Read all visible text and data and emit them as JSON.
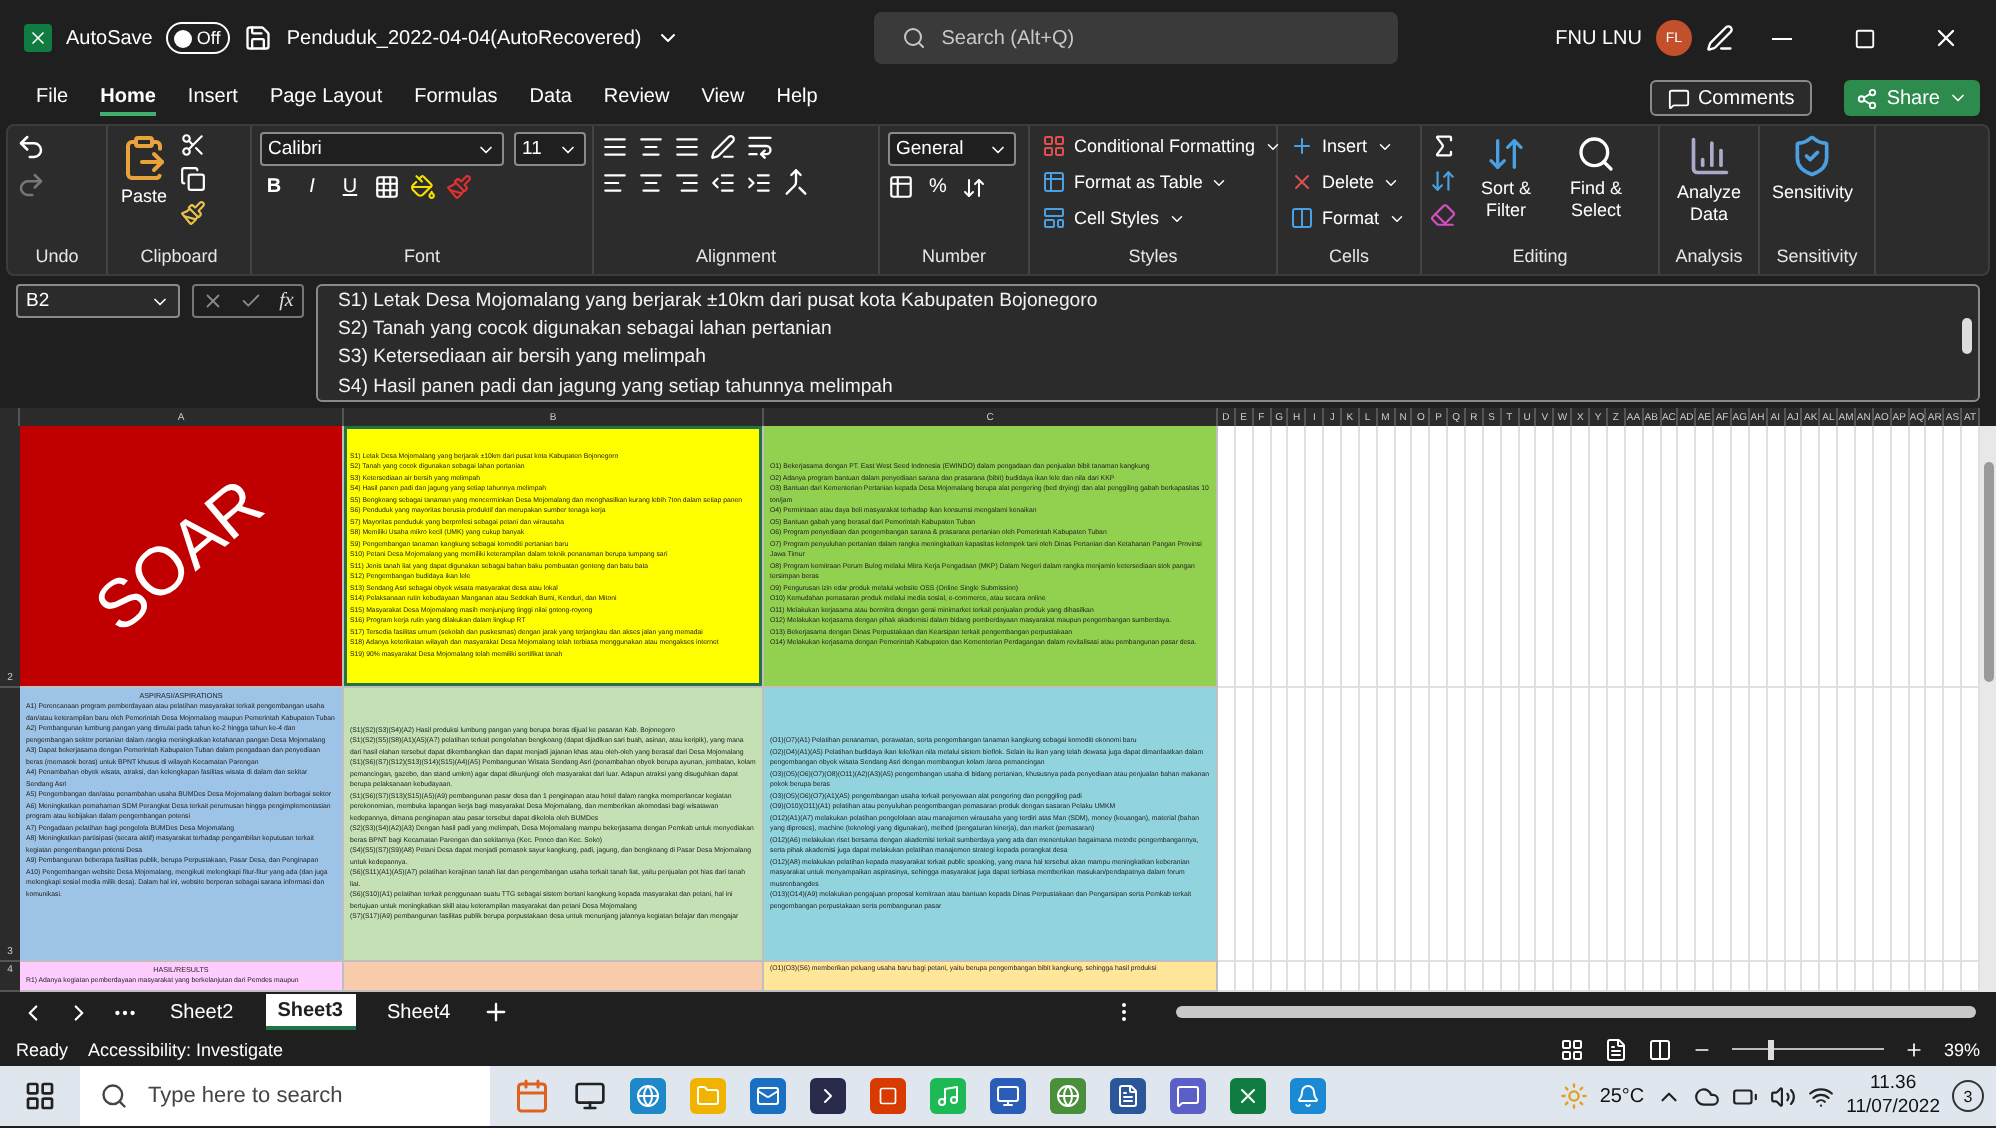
{
  "title_bar": {
    "autosave_label": "AutoSave",
    "autosave": {
      "on": false,
      "label": "Off"
    },
    "filename": "Penduduk_2022-04-04(AutoRecovered)",
    "search_placeholder": "Search (Alt+Q)",
    "user_name": "FNU LNU",
    "avatar_initials": "FL"
  },
  "menu": [
    {
      "label": "File",
      "selected": false
    },
    {
      "label": "Home",
      "selected": true
    },
    {
      "label": "Insert",
      "selected": false
    },
    {
      "label": "Page Layout",
      "selected": false
    },
    {
      "label": "Formulas",
      "selected": false
    },
    {
      "label": "Data",
      "selected": false
    },
    {
      "label": "Review",
      "selected": false
    },
    {
      "label": "View",
      "selected": false
    },
    {
      "label": "Help",
      "selected": false
    }
  ],
  "actions": {
    "comments": "Comments",
    "share": "Share"
  },
  "ribbon": [
    {
      "kind": "undo",
      "label": "Undo"
    },
    {
      "kind": "clipboard",
      "label": "Clipboard",
      "items": [
        "Paste"
      ]
    },
    {
      "kind": "font",
      "label": "Font",
      "items": [
        "Calibri",
        "11",
        "B",
        "I",
        "U"
      ]
    },
    {
      "kind": "alignment",
      "label": "Alignment"
    },
    {
      "kind": "number",
      "label": "Number",
      "items": [
        "General",
        "%"
      ]
    },
    {
      "kind": "styles",
      "label": "Styles",
      "items": [
        "Conditional Formatting",
        "Format as Table",
        "Cell Styles"
      ]
    },
    {
      "kind": "cells",
      "label": "Cells",
      "items": [
        "Insert",
        "Delete",
        "Format"
      ]
    },
    {
      "kind": "editing",
      "label": "Editing",
      "items": [
        "Sort & Filter",
        "Find & Select"
      ]
    },
    {
      "kind": "analysis",
      "label": "Analysis",
      "items": [
        "Analyze Data"
      ]
    },
    {
      "kind": "sensitivity",
      "label": "Sensitivity",
      "items": [
        "Sensitivity"
      ]
    }
  ],
  "formula_bar": {
    "name_box": "B2",
    "fx_label": "fx",
    "lines": [
      "S1) Letak Desa Mojomalang yang berjarak ±10km dari pusat kota Kabupaten Bojonegoro",
      "S2) Tanah yang cocok digunakan sebagai lahan pertanian",
      "S3) Ketersediaan air bersih yang melimpah",
      "S4) Hasil panen padi dan jagung yang setiap tahunnya melimpah"
    ]
  },
  "sheet": {
    "columns": [
      "A",
      "B",
      "C",
      "D",
      "E",
      "F",
      "G",
      "H",
      "I",
      "J",
      "K",
      "L",
      "M",
      "N",
      "O",
      "P",
      "Q",
      "R",
      "S",
      "T",
      "U",
      "V",
      "W",
      "X",
      "Y",
      "Z",
      "AA",
      "AB",
      "AC",
      "AD",
      "AE",
      "AF",
      "AG",
      "AH",
      "AI",
      "AJ",
      "AK",
      "AL",
      "AM",
      "AN",
      "AO",
      "AP",
      "AQ",
      "AR",
      "AS",
      "AT"
    ],
    "rows": [
      {
        "number": "2",
        "cells": [
          {
            "kind": "banner",
            "color": "#c00000",
            "selected": false,
            "text": "SOAR"
          },
          {
            "kind": "list",
            "color": "#ffff00",
            "selected": true,
            "lines": [
              "S1) Letak Desa Mojomalang yang berjarak ±10km dari pusat kota Kabupaten Bojonegoro",
              "S2) Tanah yang cocok digunakan sebagai lahan pertanian",
              "S3) Ketersediaan air bersih yang melimpah",
              "S4) Hasil panen padi dan jagung yang setiap tahunnya melimpah",
              "S5) Bengkoang sebagai tanaman yang mencerminkan Desa Mojomalang dan menghasilkan kurang lebih 7ton dalam setiap panen",
              "S6) Penduduk yang mayoritas berusia produktif dan merupakan sumber tenaga kerja",
              "S7) Mayoritas penduduk yang berprofesi sebagai petani dan wirausaha",
              "S8) Memiliki Usaha mikro kecil (UMK) yang cukup banyak",
              "S9) Pengembangan tanaman kangkung sebagai komoditi pertanian baru",
              "S10) Petani Desa Mojomalang yang memiliki keterampilan dalam teknik penanaman berupa tumpang sari",
              "S11) Jenis tanah liat yang dapat digunakan sebagai bahan baku pembuatan genteng dan batu bata",
              "S12) Pengembangan budidaya ikan lele",
              "S13) Sendang Asri sebagai obyek wisata masyarakat desa atau lokal",
              "S14) Pelaksanaan rutin kebudayaan Manganan atau Sedekah Bumi, Kenduri, dan Mitoni",
              "S15) Masyarakat Desa Mojomalang masih menjunjung tinggi nilai gotong-royong",
              "S16) Program kerja rutin yang dilakukan dalam lingkup RT",
              "S17) Tersedia fasilitas umum (sekolah dan puskesmas) dengan jarak yang terjangkau dan akses jalan yang memadai",
              "S18) Adanya keterikatan wilayah dan masyarakat Desa Mojomalang telah terbiasa menggunakan atau mengakses internet",
              "S19) 90% masyarakat Desa Mojomalang telah memiliki sertifikat tanah"
            ]
          },
          {
            "kind": "list",
            "color": "#92d050",
            "selected": false,
            "lines": [
              "O1) Bekerjasama dengan PT. East West Seed Indonesia (EWINDO) dalam pengadaan dan penjualan bibit tanaman kangkung",
              "O2) Adanya program bantuan dalam penyediaan sarana dan prasarana (bibit) budidaya ikan lele dan nila dari KKP",
              "O3) Bantuan dari Kementerian Pertanian kepada Desa Mojomalang berupa alat pengering (bed drying) dan alat penggiling gabah berkapasitas 10 ton/jam",
              "O4) Permintaan atau daya beli masyarakat terhadap ikan konsumsi mengalami kenaikan",
              "O5) Bantuan gabah yang berasal dari Pemerintah Kabupaten Tuban",
              "O6) Program penyediaan dan pengembangan sarana & prasarana pertanian oleh Pemerintah Kabupaten Tuban",
              "O7) Program penyuluhan pertanian dalam rangka meningkatkan kapasitas kelompok tani oleh Dinas Pertanian dan Ketahanan Pangan Provinsi Jawa Timur",
              "O8) Program kemitraan Perum Bulog melalui Mitra Kerja Pengadaan (MKP) Dalam Negeri dalam rangka menjamin ketersediaan stok pangan tersimpan beras",
              "O9) Pengurusan izin edar produk melalui website OSS (Online Single Submission)",
              "O10) Kemudahan pemasaran produk melalui media sosial, e-commerce, atau secara online",
              "O11) Melakukan kerjasama atau bermitra dengan gerai minimarket terkait penjualan produk yang dihasilkan",
              "O12) Melakukan kerjasama dengan pihak akademisi dalam bidang pemberdayaan masyarakat maupun pengembangan sumberdaya.",
              "O13) Bekerjasama dengan Dinas Perpustakaan dan Kearsipan terkait pengembangan perpustakaan",
              "O14) Melakukan kerjasama dengan Pemerintah Kabupaten dan Kementerian Perdagangan dalam revitalisasi atau pembangunan pasar desa."
            ]
          }
        ]
      },
      {
        "number": "3",
        "cells": [
          {
            "kind": "list",
            "color": "#9dc3e6",
            "selected": false,
            "heading": "ASPIRASI/ASPIRATIONS",
            "lines": [
              "A1) Perencanaan program pemberdayaan atau pelatihan masyarakat terkait pengembangan usaha dan/atau keterampilan baru oleh Pemerintah Desa Mojomalang maupun Pemerintah Kabupaten Tuban",
              "A2) Pembangunan lumbung pangan yang dimulai pada tahun ke-2 hingga tahun ke-4 dan pengembangan sektor pertanian dalam rangka meningkatkan ketahanan pangan Desa Mojomalang",
              "A3) Dapat bekerjasama dengan Pemerintah Kabupaten Tuban dalam pengadaan dan penyediaan beras (memasok beras) untuk BPNT khusus di wilayah Kecamatan Parengan",
              "A4) Penambahan obyek wisata, atraksi, dan kelengkapan fasilitas wisata di dalam dan sekitar Sendang Asri",
              "A5) Pengembangan dan/atau penambahan usaha BUMDes Desa Mojomalang dalam berbagai sektor",
              "A6) Meningkatkan pemahaman SDM Perangkat Desa terkait perumusan hingga pengimplementasian program atau kebijakan dalam pengembangan potensi",
              "A7) Pengadaan pelatihan bagi pengelola BUMDes Desa Mojomalang",
              "A8) Meningkatkan partisipasi (secara aktif) masyarakat terhadap pengambilan keputusan terkait kegiatan pengembangan potensi Desa",
              "A9) Pembangunan beberapa fasilitas publik, berupa Perpustakaan, Pasar Desa, dan Penginapan",
              "A10) Pengembangan website Desa Mojomalang, mengikuti melengkapi fitur-fitur yang ada (dan juga melengkapi sosial media milik desa). Dalam hal ini, website berperan sebagai sarana informasi dan komunikasi."
            ]
          },
          {
            "kind": "list",
            "color": "#c5e0b4",
            "selected": false,
            "lines": [
              "(S1)(S2)(S3)(S4)(A2) Hasil produksi lumbung pangan yang berupa beras dijual ke pasaran Kab. Bojonegoro",
              "(S1)(S2)(S5)(S8)(A1)(A5)(A7) pelatihan terkait pengolahan bengkoang (dapat dijadikan sari buah, asinan, atau keripik), yang mana dari hasil olahan tersebut dapat dikembangkan dan dapat menjadi jajanan khas atau oleh-oleh yang berasal dari Desa Mojomalang",
              "(S1)(S6)(S7)(S12)(S13)(S14)(S15)(A4)(A5) Pembangunan Wisata Sendang Asri (penambahan obyek berupa ayunan, jembatan, kolam pemancingan, gazebo, dan stand umkm) agar dapat dikunjungi oleh masyarakat dari luar. Adapun atraksi yang disuguhkan dapat berupa pelaksanaan kebudayaan.",
              "(S1)(S6)(S7)(S13)(S15)(A5)(A9) pembangunan pasar desa dan 1 penginapan atau hotel dalam rangka memperlancar kegiatan perekonomian, membuka lapangan kerja bagi masyarakat Desa Mojomalang, dan memberikan akomodasi bagi wisatawan kedepannya, dimana penginapan atau pasar tersebut dapat dikelola oleh BUMDes",
              "(S2)(S3)(S4)(A2)(A3) Dengan hasil padi yang melimpah, Desa Mojomalang mampu bekerjasama dengan Pemkab untuk menyediakan beras BPNT bagi Kecamatan Parengan dan sekitarnya (Kec. Ponco dan Kec. Soko)",
              "(S4)(S5)(S7)(S9)(A8) Petani Desa dapat menjadi pemasok sayur kangkung, padi, jagung, dan bengkoang di Pasar Desa Mojomalang untuk kedepannya.",
              "(S6)(S11)(A1)(A5)(A7) pelatihan kerajinan tanah liat dan pengembangan usaha terkait tanah liat, yaitu penjualan pot hias dari tanah liat.",
              "(S6)(S10)(A1) pelatihan terkait penggunaan suatu TTG sebagai sistem bertani kangkung kepada masyarakat dan petani, hal ini bertujuan untuk meningkatkan skill atau keterampilan masyarakat dan petani Desa Mojomalang",
              "(S7)(S17)(A9) pembangunan fasilitas publik berupa perpustakaan desa untuk menunjang jalannya kegiatan belajar dan mengajar"
            ]
          },
          {
            "kind": "list",
            "color": "#92d4dd",
            "selected": false,
            "lines": [
              "(O1)(O7)(A1) Pelatihan penanaman, perawatan, serta pengembangan tanaman kangkung sebagai komoditi ekonomi baru",
              "(O2)(O4)(A1)(A5) Pelatihan budidaya ikan lele/ikan nila melalui sistem bioflok. Selain itu ikan yang telah dewasa juga dapat dimanfaatkan dalam pengembangan obyek wisata Sendang Asri dengan membangun kolam /area pemancingan",
              "(O3)(O5)(O6)(O7)(O8)(O11)(A2)(A3)(A5) pengembangan usaha di bidang pertanian, khususnya pada penyediaan atau penjualan bahan makanan pokok berupa beras",
              "(O3)(O5)(O6)(O7)(A1)(A5) pengembangan usaha terkait penyewaan alat pengering dan penggiling padi",
              "(O9)(O10)(O11)(A1) pelatihan atau penyuluhan pengembangan pemasaran produk dengan sasaran Pelaku UMKM",
              "(O12)(A1)(A7) melakukan pelatihan pengelolaan atau manajemen wirausaha yang terdiri atas Man (SDM), money (keuangan), material (bahan yang diproses), machine (teknologi yang digunakan), method (pengaturan kinerja), dan market (pemasaran)",
              "(O12)(A6) melakukan riset bersama dengan akademisi terkait sumberdaya yang ada dan menentukan bagaimana metode pengembangannya, serta pihak akademisi juga dapat melakukan pelatihan manajemen strategi kepada perangkat desa",
              "(O12)(A8) melakukan pelatihan kepada masyarakat terkait public speaking, yang mana hal tersebut akan mampu meningkatkan keberanian masyarakat untuk menyampaikan aspirasinya, sehingga masyarakat juga dapat terbiasa memberikan masukan/pendapatnya dalam forum musrenbangdes",
              "(O13)(O14)(A9) melakukan pengajuan proposal kemitraan atau bantuan kepada Dinas Perpustakaan dan Pengarsipan serta Pemkab terkait pengembangan perpustakaan serta pembangunan pasar"
            ]
          }
        ]
      },
      {
        "number": "4",
        "cells": [
          {
            "kind": "list",
            "color": "#ffccff",
            "selected": false,
            "heading": "HASIL/RESULTS",
            "lines": [
              "R1) Adanya kegiatan pemberdayaan masyarakat yang berkelanjutan dari Pemdes maupun"
            ]
          },
          {
            "kind": "list",
            "color": "#f8cbad",
            "selected": false
          },
          {
            "kind": "list",
            "color": "#ffe699",
            "selected": false,
            "lines": [
              "(O1)(O3)(S6) memberikan peluang usaha baru bagi petani, yaitu berupa pengembangan bibit kangkung, sehingga hasil produksi"
            ]
          }
        ]
      }
    ]
  },
  "sheet_tabs": [
    {
      "label": "Sheet2",
      "selected": false
    },
    {
      "label": "Sheet3",
      "selected": true
    },
    {
      "label": "Sheet4",
      "selected": false
    }
  ],
  "status_bar": {
    "mode": "Ready",
    "accessibility": "Accessibility: Investigate",
    "zoom": "39%",
    "zoom_slider": {
      "level": 0.24
    }
  },
  "taskbar": {
    "search_placeholder": "Type here to search",
    "temperature": "25°C",
    "time": "11.36",
    "date": "11/07/2022",
    "notifications": "3"
  }
}
